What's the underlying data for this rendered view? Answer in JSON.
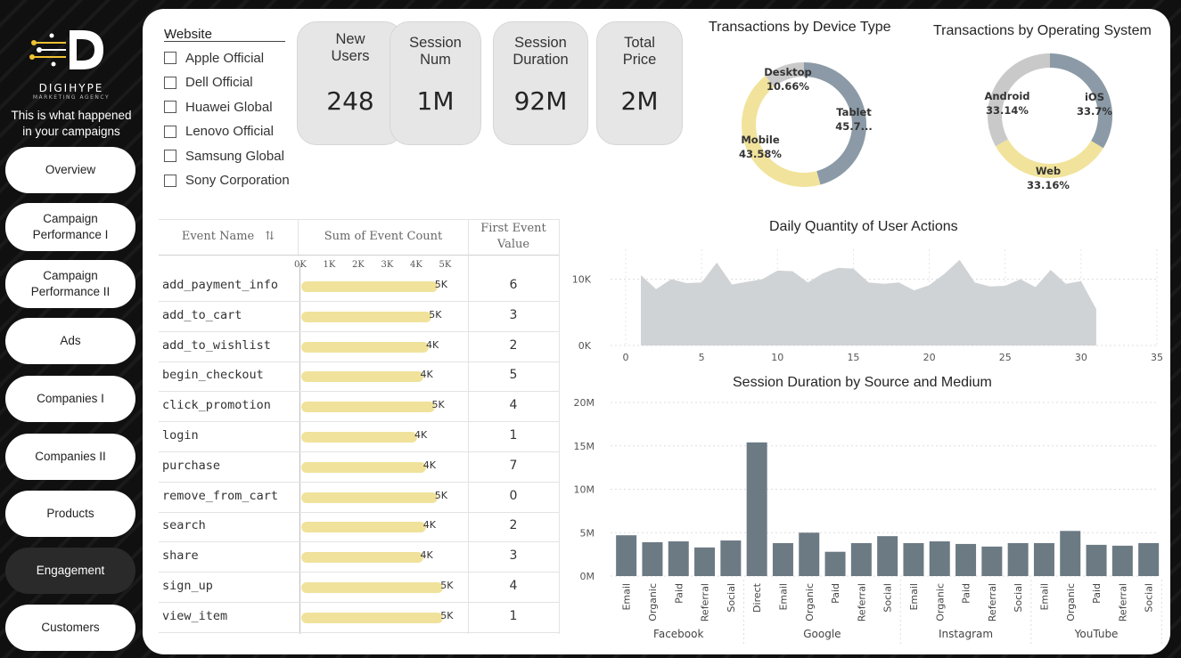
{
  "brand": {
    "name": "DIGIHYPE",
    "subtitle": "MARKETING AGENCY",
    "tagline_line1": "This is what happened",
    "tagline_line2": "in your campaigns"
  },
  "nav": [
    {
      "label": "Overview",
      "active": false
    },
    {
      "label": "Campaign Performance I",
      "active": false
    },
    {
      "label": "Campaign Performance II",
      "active": false
    },
    {
      "label": "Ads",
      "active": false
    },
    {
      "label": "Companies I",
      "active": false
    },
    {
      "label": "Companies II",
      "active": false
    },
    {
      "label": "Products",
      "active": false
    },
    {
      "label": "Engagement",
      "active": true
    },
    {
      "label": "Customers",
      "active": false
    }
  ],
  "slicer": {
    "title": "Website",
    "items": [
      "Apple Official",
      "Dell Official",
      "Huawei Global",
      "Lenovo Official",
      "Samsung Global",
      "Sony Corporation"
    ]
  },
  "cards": [
    {
      "line1": "New",
      "line2": "Users",
      "value": "248"
    },
    {
      "line1": "Session",
      "line2": "Num",
      "value": "1M"
    },
    {
      "line1": "Session",
      "line2": "Duration",
      "value": "92M"
    },
    {
      "line1": "Total",
      "line2": "Price",
      "value": "2M"
    }
  ],
  "table": {
    "col_event": "Event Name",
    "col_sum": "Sum of Event Count",
    "col_first_1": "First Event",
    "col_first_2": "Value",
    "axis_ticks": [
      "0K",
      "1K",
      "2K",
      "3K",
      "4K",
      "5K"
    ],
    "rows": [
      {
        "name": "add_payment_info",
        "count": 4.7,
        "label": "5K",
        "first": "6"
      },
      {
        "name": "add_to_cart",
        "count": 4.5,
        "label": "5K",
        "first": "3"
      },
      {
        "name": "add_to_wishlist",
        "count": 4.4,
        "label": "4K",
        "first": "2"
      },
      {
        "name": "begin_checkout",
        "count": 4.2,
        "label": "4K",
        "first": "5"
      },
      {
        "name": "click_promotion",
        "count": 4.6,
        "label": "5K",
        "first": "4"
      },
      {
        "name": "login",
        "count": 4.0,
        "label": "4K",
        "first": "1"
      },
      {
        "name": "purchase",
        "count": 4.3,
        "label": "4K",
        "first": "7"
      },
      {
        "name": "remove_from_cart",
        "count": 4.7,
        "label": "5K",
        "first": "0"
      },
      {
        "name": "search",
        "count": 4.3,
        "label": "4K",
        "first": "2"
      },
      {
        "name": "share",
        "count": 4.2,
        "label": "4K",
        "first": "3"
      },
      {
        "name": "sign_up",
        "count": 4.9,
        "label": "5K",
        "first": "4"
      },
      {
        "name": "view_item",
        "count": 4.9,
        "label": "5K",
        "first": "1"
      }
    ]
  },
  "chart_data": [
    {
      "type": "pie",
      "title": "Transactions by Device Type",
      "labels": [
        "Tablet",
        "Mobile",
        "Desktop"
      ],
      "values": [
        45.76,
        43.58,
        10.66
      ],
      "display": [
        "45.7...",
        "43.58%",
        "10.66%"
      ],
      "colors": [
        "#8b9aa6",
        "#f1e39b",
        "#c9c9c9"
      ]
    },
    {
      "type": "pie",
      "title": "Transactions by Operating System",
      "labels": [
        "iOS",
        "Web",
        "Android"
      ],
      "values": [
        33.7,
        33.16,
        33.14
      ],
      "display": [
        "33.7%",
        "33.16%",
        "33.14%"
      ],
      "colors": [
        "#8b9aa6",
        "#f1e39b",
        "#c9c9c9"
      ]
    },
    {
      "type": "area",
      "title": "Daily Quantity of User Actions",
      "x": [
        1,
        2,
        3,
        4,
        5,
        6,
        7,
        8,
        9,
        10,
        11,
        12,
        13,
        14,
        15,
        16,
        17,
        18,
        19,
        20,
        21,
        22,
        23,
        24,
        25,
        26,
        27,
        28,
        29,
        30,
        31
      ],
      "y": [
        10600,
        8500,
        10000,
        9400,
        9500,
        12500,
        9200,
        9600,
        10000,
        11300,
        11200,
        9500,
        10900,
        11700,
        11600,
        9500,
        9300,
        9500,
        8300,
        9100,
        10800,
        12900,
        9500,
        8900,
        9000,
        10000,
        8800,
        11400,
        9300,
        9700,
        5500
      ],
      "xlim": [
        -1,
        35
      ],
      "ylim": [
        0,
        14500
      ],
      "xticks": [
        "0",
        "5",
        "10",
        "15",
        "20",
        "25",
        "30",
        "35"
      ],
      "yticks": [
        "0K",
        "10K"
      ],
      "color": "#cfd3d6"
    },
    {
      "type": "bar",
      "title": "Session Duration by Source and Medium",
      "groups": [
        {
          "name": "Facebook",
          "categories": [
            "Email",
            "Organic",
            "Paid",
            "Referral",
            "Social"
          ],
          "values": [
            4.7,
            3.9,
            4.0,
            3.3,
            4.1
          ]
        },
        {
          "name": "Google",
          "categories": [
            "Direct",
            "Email",
            "Organic",
            "Paid",
            "Referral",
            "Social"
          ],
          "values": [
            15.4,
            3.8,
            5.0,
            2.8,
            3.8,
            4.6
          ]
        },
        {
          "name": "Instagram",
          "categories": [
            "Email",
            "Organic",
            "Paid",
            "Referral",
            "Social"
          ],
          "values": [
            3.8,
            4.0,
            3.7,
            3.4,
            3.8
          ]
        },
        {
          "name": "YouTube",
          "categories": [
            "Email",
            "Organic",
            "Paid",
            "Referral",
            "Social"
          ],
          "values": [
            3.8,
            5.2,
            3.6,
            3.5,
            3.8
          ]
        }
      ],
      "unit": "M",
      "ylim": [
        0,
        20
      ],
      "yticks": [
        "0M",
        "5M",
        "10M",
        "15M",
        "20M"
      ],
      "color": "#6c7a84"
    }
  ]
}
